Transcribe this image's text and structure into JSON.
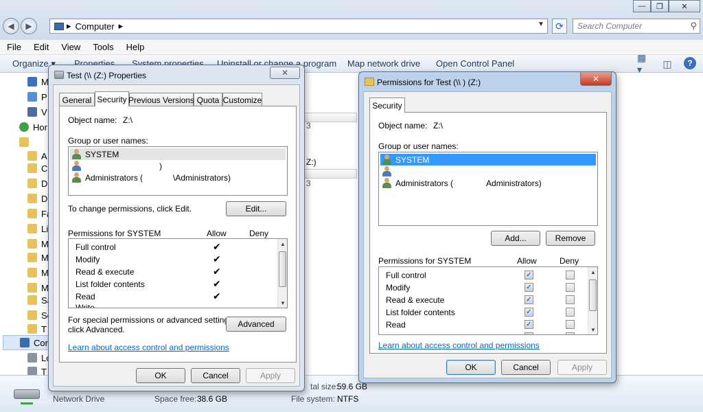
{
  "explorer": {
    "window_controls": {
      "minimize": "—",
      "maximize": "❐",
      "close": "✕"
    },
    "address": {
      "root_arrow": "▸",
      "crumb": "Computer",
      "trail_arrow": "▸"
    },
    "search_placeholder": "Search Computer",
    "menus": [
      "File",
      "Edit",
      "View",
      "Tools",
      "Help"
    ],
    "commands": {
      "organize": "Organize ▾",
      "properties": "Properties",
      "system_properties": "System properties",
      "uninstall": "Uninstall or change a program",
      "map_drive": "Map network drive",
      "control_panel": "Open Control Panel"
    },
    "nav_items": [
      "M",
      "P",
      "V",
      "Hor",
      "",
      "A",
      "C",
      "D",
      "D",
      "Fa",
      "Li",
      "M",
      "M",
      "M",
      "M",
      "Sa",
      "Se",
      "T",
      "Cor",
      "Lo",
      "T"
    ],
    "content_fragments": [
      "3",
      "Z:)",
      "3"
    ],
    "details": {
      "name": "Network Drive",
      "space_free_label": "Space free:",
      "space_free": "38.6 GB",
      "total_size_label": "tal size:",
      "total_size": "59.6 GB",
      "fs_label": "File system:",
      "fs": "NTFS"
    }
  },
  "props_dialog": {
    "title": "Test (\\\\            (Z:) Properties",
    "close": "✕",
    "tabs": [
      "General",
      "Security",
      "Previous Versions",
      "Quota",
      "Customize"
    ],
    "object_label": "Object name:",
    "object_value": "Z:\\",
    "group_label": "Group or user names:",
    "users": [
      {
        "name": "SYSTEM",
        "tail": ""
      },
      {
        "name": "",
        "tail": ")"
      },
      {
        "name": "Administrators (",
        "tail": "\\Administrators)"
      }
    ],
    "change_text": "To change permissions, click Edit.",
    "edit_button": "Edit...",
    "perm_header": "Permissions for SYSTEM",
    "allow": "Allow",
    "deny": "Deny",
    "perms": [
      "Full control",
      "Modify",
      "Read & execute",
      "List folder contents",
      "Read",
      "Write"
    ],
    "check": "✔",
    "special_text_1": "For special permissions or advanced settings,",
    "special_text_2": "click Advanced.",
    "advanced_button": "Advanced",
    "learn_link": "Learn about access control and permissions",
    "ok": "OK",
    "cancel": "Cancel",
    "apply": "Apply"
  },
  "perm_dialog": {
    "title": "Permissions for Test (\\\\            ) (Z:)",
    "close": "✕",
    "tab": "Security",
    "object_label": "Object name:",
    "object_value": "Z:\\",
    "group_label": "Group or user names:",
    "users": [
      {
        "name": "SYSTEM",
        "tail": ""
      },
      {
        "name": "",
        "tail": ""
      },
      {
        "name": "Administrators (",
        "tail": "Administrators)"
      }
    ],
    "add_button": "Add...",
    "remove_button": "Remove",
    "perm_header": "Permissions for SYSTEM",
    "allow": "Allow",
    "deny": "Deny",
    "perms": [
      "Full control",
      "Modify",
      "Read & execute",
      "List folder contents",
      "Read"
    ],
    "check": "✓",
    "learn_link": "Learn about access control and permissions",
    "ok": "OK",
    "cancel": "Cancel",
    "apply": "Apply"
  }
}
